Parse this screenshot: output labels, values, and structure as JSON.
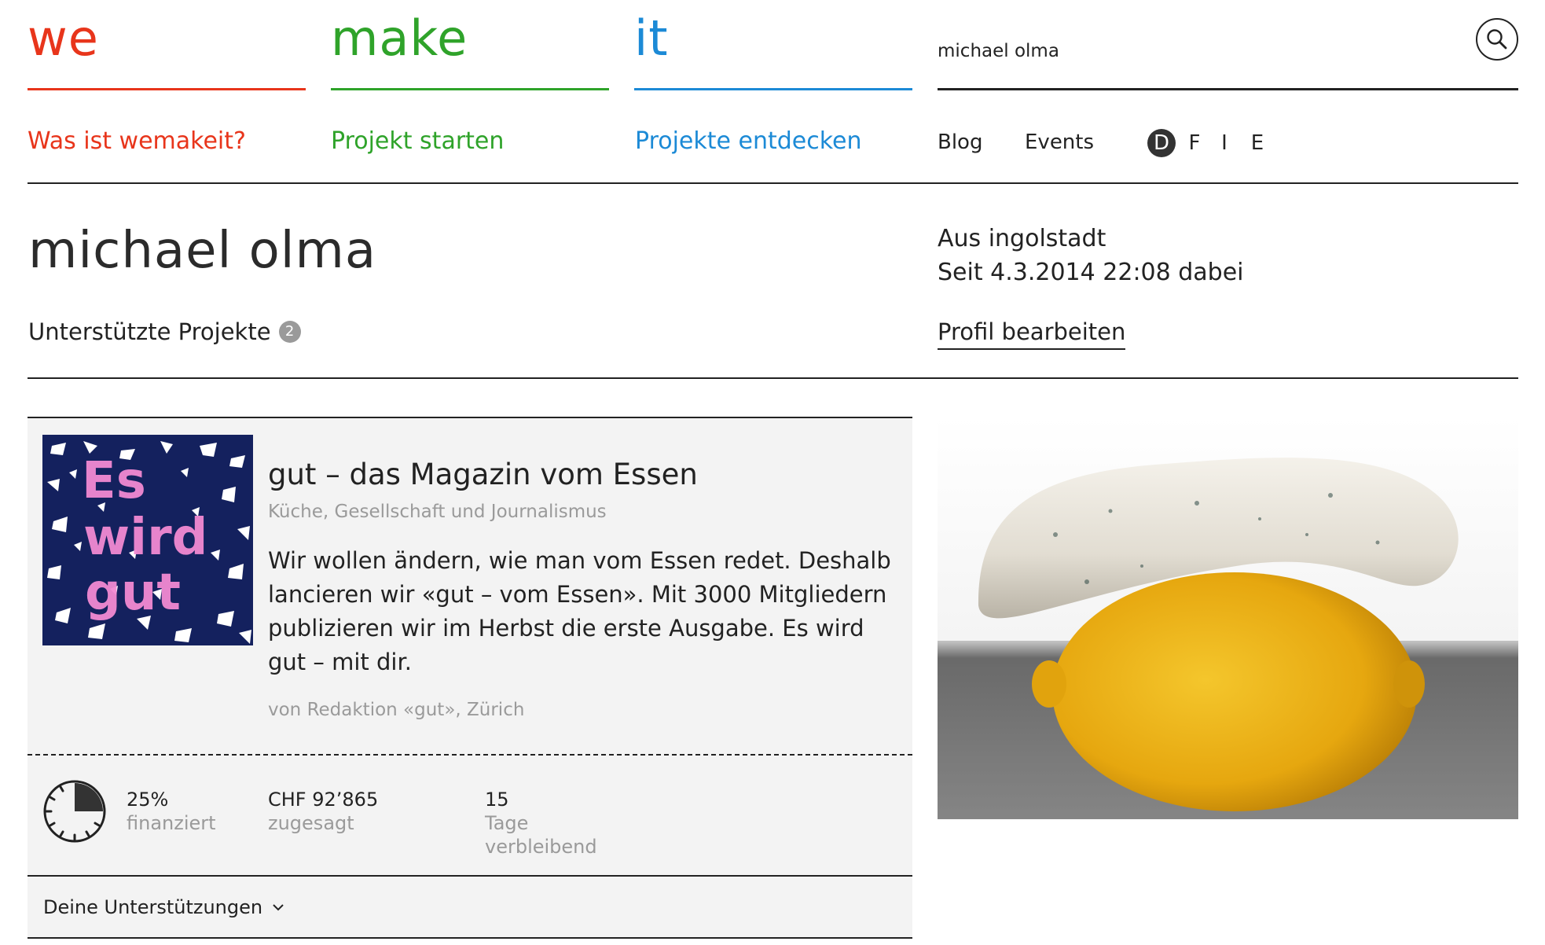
{
  "brand": {
    "we": "we",
    "make": "make",
    "it": "it"
  },
  "search": {
    "value": "michael olma",
    "icon": "search-icon"
  },
  "nav": {
    "about": "Was ist wemakeit?",
    "start": "Projekt starten",
    "discover": "Projekte entdecken",
    "blog": "Blog",
    "events": "Events",
    "languages": [
      "D",
      "F",
      "I",
      "E"
    ],
    "active_language": "D"
  },
  "colors": {
    "red": "#e8351b",
    "green": "#2fa32a",
    "blue": "#1c8ad6"
  },
  "profile": {
    "name": "michael olma",
    "supported_label": "Unterstützte Projekte",
    "supported_count": "2",
    "location": "Aus ingolstadt",
    "since": "Seit 4.3.2014 22:08 dabei",
    "edit_label": "Profil bearbeiten"
  },
  "project": {
    "title": "gut – das Magazin vom Essen",
    "category": "Küche, Gesellschaft und Journalismus",
    "description": "Wir wollen ändern, wie man vom Essen redet. Deshalb lancieren wir «gut – vom Essen». Mit 3000 Mitgliedern publizieren wir im Herbst die erste Ausgabe. Es wird gut – mit dir.",
    "by": "von Redaktion «gut», Zürich",
    "thumb_text": [
      "Es",
      "wird",
      "gut"
    ],
    "funded_pct": "25%",
    "funded_fraction": 0.25,
    "funded_label": "finanziert",
    "pledged_value": "CHF 92’865",
    "pledged_label": "zugesagt",
    "days_value": "15",
    "days_label_1": "Tage",
    "days_label_2": "verbleibend",
    "support_toggle": "Deine Unterstützungen"
  }
}
